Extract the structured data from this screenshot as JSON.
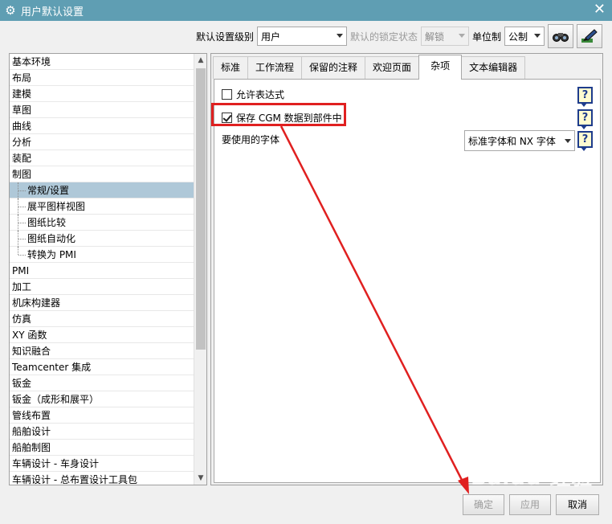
{
  "window": {
    "title": "用户默认设置"
  },
  "toolbar": {
    "level_label": "默认设置级别",
    "level_value": "用户",
    "lock_label": "默认的锁定状态",
    "lock_value": "解锁",
    "unit_label": "单位制",
    "unit_value": "公制"
  },
  "tree": {
    "items": [
      {
        "label": "基本环境"
      },
      {
        "label": "布局"
      },
      {
        "label": "建模"
      },
      {
        "label": "草图"
      },
      {
        "label": "曲线"
      },
      {
        "label": "分析"
      },
      {
        "label": "装配"
      },
      {
        "label": "制图"
      },
      {
        "label": "常规/设置"
      },
      {
        "label": "展平图样视图"
      },
      {
        "label": "图纸比较"
      },
      {
        "label": "图纸自动化"
      },
      {
        "label": "转换为 PMI"
      },
      {
        "label": "PMI"
      },
      {
        "label": "加工"
      },
      {
        "label": "机床构建器"
      },
      {
        "label": "仿真"
      },
      {
        "label": "XY 函数"
      },
      {
        "label": "知识融合"
      },
      {
        "label": "Teamcenter 集成"
      },
      {
        "label": "钣金"
      },
      {
        "label": "钣金（成形和展平）"
      },
      {
        "label": "管线布置"
      },
      {
        "label": "船舶设计"
      },
      {
        "label": "船舶制图"
      },
      {
        "label": "车辆设计 - 车身设计"
      },
      {
        "label": "车辆设计 - 总布置设计工具包"
      }
    ]
  },
  "tabs": [
    {
      "label": "标准"
    },
    {
      "label": "工作流程"
    },
    {
      "label": "保留的注释"
    },
    {
      "label": "欢迎页面"
    },
    {
      "label": "杂项"
    },
    {
      "label": "文本编辑器"
    }
  ],
  "misc": {
    "allow_expressions": "允许表达式",
    "save_cgm": "保存 CGM 数据到部件中",
    "font_label": "要使用的字体",
    "font_value": "标准字体和 NX 字体",
    "help_glyph": "?"
  },
  "buttons": {
    "ok": "确定",
    "apply": "应用",
    "cancel": "取消"
  },
  "watermark": "Baidu 经验",
  "colors": {
    "titlebar": "#5f9eb3",
    "selected_row": "#afc8d8",
    "highlight_red": "#e02020"
  }
}
